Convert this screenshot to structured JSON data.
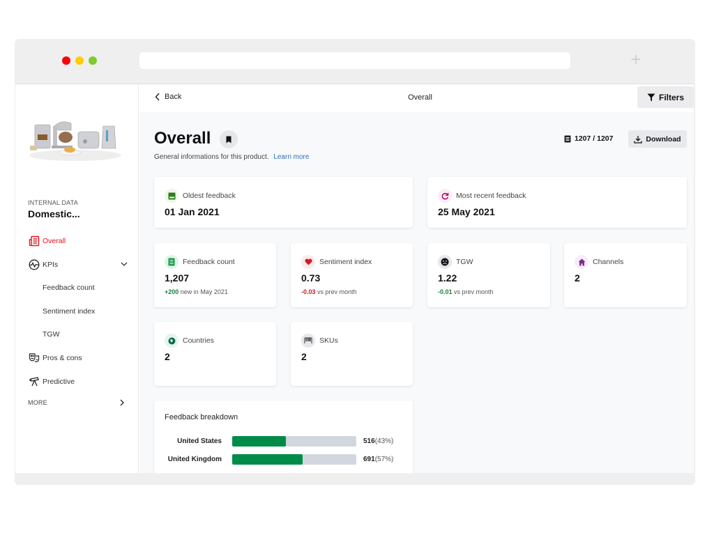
{
  "browser": {
    "new_tab_symbol": "+"
  },
  "sidebar": {
    "product_image_alt": "Kitchen appliances",
    "section_label": "INTERNAL DATA",
    "product_name": "Domestic...",
    "nav": [
      {
        "label": "Overall",
        "icon": "newspaper-icon",
        "active": true
      },
      {
        "label": "KPIs",
        "icon": "pulse-icon",
        "expanded": true
      },
      {
        "label": "Pros & cons",
        "icon": "theater-masks-icon"
      },
      {
        "label": "Predictive",
        "icon": "telescope-icon"
      }
    ],
    "kpi_subitems": [
      "Feedback count",
      "Sentiment index",
      "TGW"
    ],
    "more_label": "MORE"
  },
  "topbar": {
    "back_label": "Back",
    "title": "Overall",
    "filters_label": "Filters"
  },
  "header": {
    "title": "Overall",
    "subtitle": "General informations for this product.",
    "learn_more": "Learn more",
    "count": "1207 / 1207",
    "download_label": "Download"
  },
  "cards": {
    "oldest": {
      "label": "Oldest feedback",
      "value": "01 Jan 2021",
      "icon": "book-icon",
      "color": "#2e7d1f",
      "bg": "#eef7e6"
    },
    "recent": {
      "label": "Most recent feedback",
      "value": "25 May 2021",
      "icon": "refresh-icon",
      "color": "#b0127a",
      "bg": "#fcebf5"
    },
    "feedback_count": {
      "label": "Feedback count",
      "value": "1,207",
      "delta": "+200",
      "delta_text": "new in May 2021",
      "icon": "document-icon",
      "color": "#1a9a4a",
      "bg": "#dcf6e6"
    },
    "sentiment": {
      "label": "Sentiment index",
      "value": "0.73",
      "delta": "-0.03",
      "delta_text": "vs prev month",
      "icon": "heart-icon",
      "color": "#c81d25",
      "bg": "#fde8ea"
    },
    "tgw": {
      "label": "TGW",
      "value": "1.22",
      "delta": "-0.01",
      "delta_text": "vs prev month",
      "icon": "sad-face-icon",
      "color": "#111111",
      "bg": "#e6e7ea"
    },
    "channels": {
      "label": "Channels",
      "value": "2",
      "icon": "home-icon",
      "color": "#7b2d8e",
      "bg": "#f8ecfb"
    },
    "countries": {
      "label": "Countries",
      "value": "2",
      "icon": "globe-icon",
      "color": "#0f6b47",
      "bg": "#e2f5ee"
    },
    "skus": {
      "label": "SKUs",
      "value": "2",
      "icon": "barcode-icon",
      "color": "#333333",
      "bg": "#e6e7ea"
    }
  },
  "breakdown": {
    "title": "Feedback breakdown",
    "bar_color": "#008c48",
    "track_color": "#d2d6de",
    "rows": [
      {
        "name": "United States",
        "count": "516",
        "percent_label": "(43%)",
        "share": 0.43
      },
      {
        "name": "United Kingdom",
        "count": "691",
        "percent_label": "(57%)",
        "share": 0.57
      }
    ]
  }
}
